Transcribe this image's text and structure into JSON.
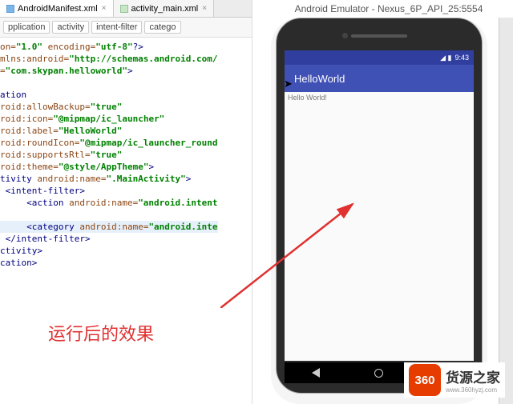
{
  "tabs": {
    "items": [
      {
        "label": "AndroidManifest.xml",
        "active": true
      },
      {
        "label": "activity_main.xml",
        "active": false
      }
    ]
  },
  "breadcrumb": {
    "items": [
      "pplication",
      "activity",
      "intent-filter",
      "catego"
    ]
  },
  "code": {
    "l01a": "on=",
    "l01b": "\"1.0\"",
    "l01c": " encoding=",
    "l01d": "\"utf-8\"",
    "l01e": "?>",
    "l02a": "mlns:android=",
    "l02b": "\"http://schemas.android.com/",
    "l03a": "=",
    "l03b": "\"com.skypan.helloworld\"",
    "l03c": ">",
    "l04": "ation",
    "l05a": "roid:allowBackup=",
    "l05b": "\"true\"",
    "l06a": "roid:icon=",
    "l06b": "\"@mipmap/ic_launcher\"",
    "l07a": "roid:label=",
    "l07b": "\"HelloWorld\"",
    "l08a": "roid:roundIcon=",
    "l08b": "\"@mipmap/ic_launcher_round",
    "l09a": "roid:supportsRtl=",
    "l09b": "\"true\"",
    "l10a": "roid:theme=",
    "l10b": "\"@style/AppTheme\"",
    "l10c": ">",
    "l11a": "tivity ",
    "l11b": "android:name=",
    "l11c": "\".MainActivity\"",
    "l11d": ">",
    "l12": " <intent-filter>",
    "l13a": "     <action ",
    "l13b": "android:name=",
    "l13c": "\"android.intent",
    "l14a": "     <category ",
    "l14b": "android:name=",
    "l14c": "\"android.inte",
    "l15": " </intent-filter>",
    "l16": "ctivity>",
    "l17": "cation>"
  },
  "emulator": {
    "window_title": "Android Emulator - Nexus_6P_API_25:5554",
    "status": {
      "time": "9:43",
      "icons": "◢ ▮"
    },
    "appbar": {
      "title": "HelloWorld"
    },
    "content": {
      "text": "Hello World!"
    }
  },
  "annotation": {
    "text": "运行后的效果"
  },
  "watermark": {
    "badge": "360",
    "text": "货源之家",
    "sub": "www.360hyzj.com"
  }
}
